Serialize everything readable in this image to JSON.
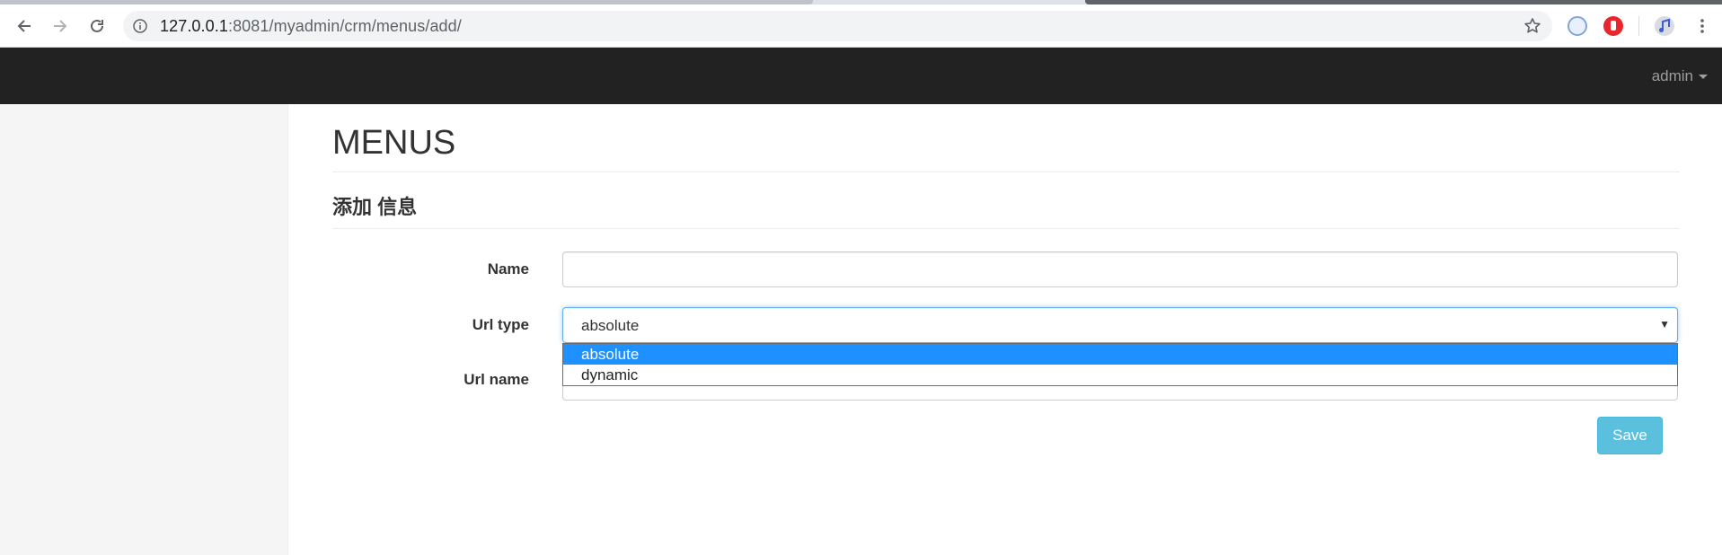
{
  "browser": {
    "url_host": "127.0.0.1",
    "url_rest": ":8081/myadmin/crm/menus/add/",
    "icons": [
      "back-arrow-icon",
      "forward-arrow-icon",
      "reload-icon",
      "info-icon",
      "star-icon",
      "kebab-menu-icon"
    ],
    "extensions": [
      "extension-blue-icon",
      "extension-red-stop-icon",
      "extension-music-icon"
    ]
  },
  "navbar": {
    "user_label": "admin"
  },
  "page": {
    "title": "MENUS",
    "subheading": "添加 信息"
  },
  "form": {
    "name_label": "Name",
    "name_value": "",
    "url_type_label": "Url type",
    "url_type_value": "absolute",
    "url_type_options": [
      "absolute",
      "dynamic"
    ],
    "url_name_label": "Url name",
    "url_name_value": "",
    "save_label": "Save"
  },
  "colors": {
    "navbar_bg": "#222222",
    "sidebar_bg": "#f5f5f5",
    "option_highlight": "#1e90ff",
    "save_button": "#5bc0de",
    "focus_border": "#66afe9"
  }
}
